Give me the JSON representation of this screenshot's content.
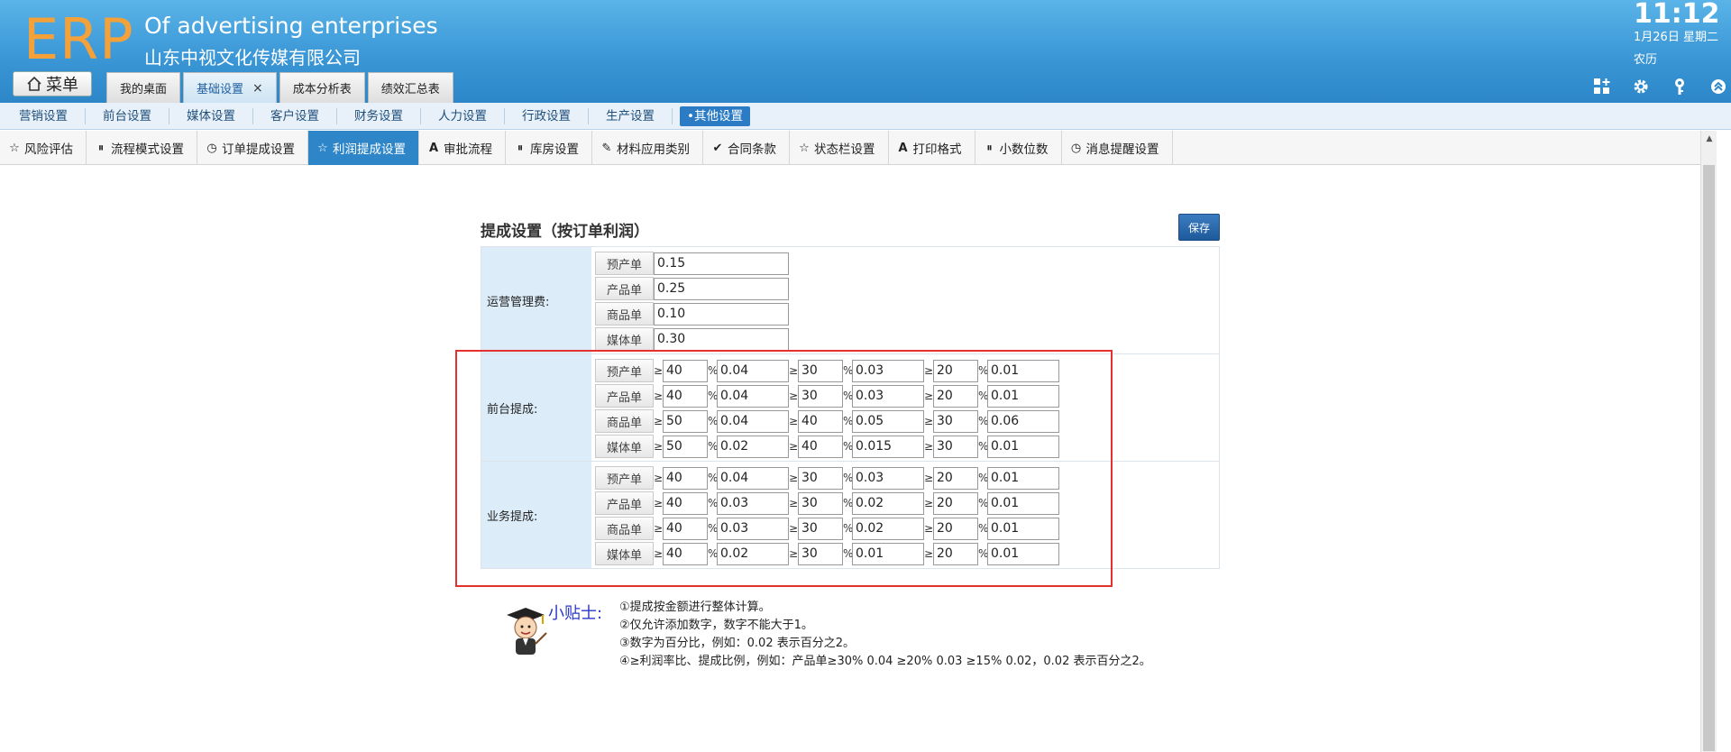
{
  "header": {
    "logo": "ERP",
    "company_en": "Of advertising enterprises",
    "company_cn": "山东中视文化传媒有限公司",
    "clock": "11:12",
    "date": "1月26日 星期二",
    "lunar": "农历",
    "icons": [
      "grid-add-icon",
      "gear-icon",
      "key-icon",
      "chevron-up-circle-icon"
    ],
    "menu_label": "菜单",
    "tabs": [
      {
        "label": "我的桌面"
      },
      {
        "label": "基础设置",
        "close": "×"
      },
      {
        "label": "成本分析表"
      },
      {
        "label": "绩效汇总表"
      }
    ]
  },
  "nav1": [
    "营销设置",
    "前台设置",
    "媒体设置",
    "客户设置",
    "财务设置",
    "人力设置",
    "行政设置",
    "生产设置",
    "•其他设置"
  ],
  "nav2": [
    "风险评估",
    "流程模式设置",
    "订单提成设置",
    "利润提成设置",
    "审批流程",
    "库房设置",
    "材料应用类别",
    "合同条款",
    "状态栏设置",
    "打印格式",
    "小数位数",
    "消息提醒设置"
  ],
  "panel": {
    "title": "提成设置（按订单利润）",
    "save": "保存",
    "sections": [
      {
        "label": "运营管理费:",
        "rows": [
          {
            "tag": "预产单",
            "value": "0.15"
          },
          {
            "tag": "产品单",
            "value": "0.25"
          },
          {
            "tag": "商品单",
            "value": "0.10"
          },
          {
            "tag": "媒体单",
            "value": "0.30"
          }
        ]
      },
      {
        "label": "前台提成:",
        "rows": [
          {
            "tag": "预产单",
            "v": [
              "40",
              "0.04",
              "30",
              "0.03",
              "20",
              "0.01"
            ]
          },
          {
            "tag": "产品单",
            "v": [
              "40",
              "0.04",
              "30",
              "0.03",
              "20",
              "0.01"
            ]
          },
          {
            "tag": "商品单",
            "v": [
              "50",
              "0.04",
              "40",
              "0.05",
              "30",
              "0.06"
            ]
          },
          {
            "tag": "媒体单",
            "v": [
              "50",
              "0.02",
              "40",
              "0.015",
              "30",
              "0.01"
            ]
          }
        ]
      },
      {
        "label": "业务提成:",
        "rows": [
          {
            "tag": "预产单",
            "v": [
              "40",
              "0.04",
              "30",
              "0.03",
              "20",
              "0.01"
            ]
          },
          {
            "tag": "产品单",
            "v": [
              "40",
              "0.03",
              "30",
              "0.02",
              "20",
              "0.01"
            ]
          },
          {
            "tag": "商品单",
            "v": [
              "40",
              "0.03",
              "30",
              "0.02",
              "20",
              "0.01"
            ]
          },
          {
            "tag": "媒体单",
            "v": [
              "40",
              "0.02",
              "30",
              "0.01",
              "20",
              "0.01"
            ]
          }
        ]
      }
    ],
    "ge": "≥",
    "pct": "%"
  },
  "tips": {
    "title": "小贴士:",
    "lines": [
      "①提成按金额进行整体计算。",
      "②仅允许添加数字，数字不能大于1。",
      "③数字为百分比，例如：0.02 表示百分之2。",
      "④≥利润率比、提成比例，例如：产品单≥30% 0.04 ≥20% 0.03 ≥15% 0.02，0.02 表示百分之2。"
    ]
  },
  "colors": {
    "accent": "#2e86c9",
    "highlight": "#e53030",
    "logo": "#f5a13a"
  }
}
